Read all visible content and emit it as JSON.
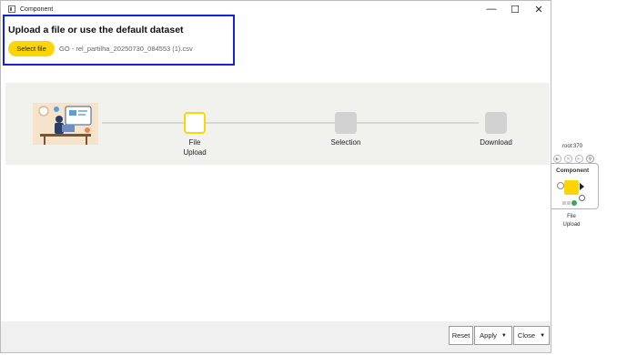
{
  "window": {
    "title": "Component",
    "controls": {
      "minimize": "—",
      "maximize": "☐",
      "close": "✕"
    }
  },
  "upload": {
    "title": "Upload a file or use the default dataset",
    "button_label": "Select file",
    "file_name": "GO - rel_partilha_20250730_084553 (1).csv"
  },
  "steps": [
    {
      "label": "File\nUpload",
      "state": "active"
    },
    {
      "label": "Selection",
      "state": "inactive"
    },
    {
      "label": "Download",
      "state": "inactive"
    }
  ],
  "footer": {
    "reset_label": "Reset",
    "apply_label": "Apply",
    "close_label": "Close"
  },
  "node": {
    "id": "root:370",
    "title": "Component",
    "label": "File\nUpload",
    "colors": {
      "body": "#ffd500",
      "status": "#3aa757"
    }
  },
  "colors": {
    "accent": "#ffd500",
    "highlight_border": "#1622d8",
    "band": "#f1f1ee"
  }
}
